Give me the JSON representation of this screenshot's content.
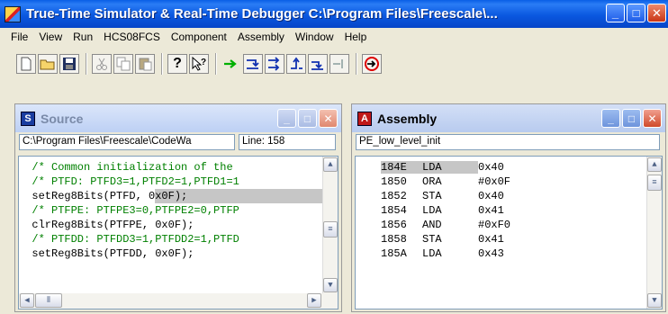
{
  "app": {
    "title": "True-Time Simulator & Real-Time Debugger   C:\\Program Files\\Freescale\\...",
    "min_label": "_",
    "max_label": "□",
    "close_label": "✕"
  },
  "menu": [
    "File",
    "View",
    "Run",
    "HCS08FCS",
    "Component",
    "Assembly",
    "Window",
    "Help"
  ],
  "toolbar": {
    "icons": [
      "new-file-icon",
      "open-folder-icon",
      "save-icon",
      "cut-icon",
      "copy-icon",
      "paste-icon",
      "help-icon",
      "context-help-icon",
      "start-continue-icon",
      "single-step-icon",
      "step-over-icon",
      "step-out-icon",
      "assembly-step-icon",
      "halt-icon",
      "reset-icon"
    ],
    "glyphs": {
      "new": "🗋",
      "open": "📂",
      "save": "💾",
      "cut": "✂",
      "copy": "⎘",
      "paste": "📋",
      "help": "?",
      "context_help": "?",
      "go": "→",
      "step": "⇥",
      "step_over": "⇉",
      "step_out": "↰",
      "asm_step": "⇣",
      "halt": "⏸",
      "reset": "⟲"
    }
  },
  "source_window": {
    "title": "Source",
    "icon_letter": "S",
    "path": "C:\\Program Files\\Freescale\\CodeWa",
    "line_info": "Line: 158",
    "lines": [
      {
        "text": "  /* Common initialization of the",
        "type": "comment"
      },
      {
        "text": "  /* PTFD: PTFD3=1,PTFD2=1,PTFD1=1",
        "type": "comment"
      },
      {
        "text": "  setReg8Bits(PTFD, 0x0F);",
        "type": "code",
        "highlight_from": 21
      },
      {
        "text": "  /* PTFPE: PTFPE3=0,PTFPE2=0,PTFP",
        "type": "comment"
      },
      {
        "text": "  clrReg8Bits(PTFPE, 0x0F);",
        "type": "code"
      },
      {
        "text": "  /* PTFDD: PTFDD3=1,PTFDD2=1,PTFD",
        "type": "comment"
      },
      {
        "text": "  setReg8Bits(PTFDD, 0x0F);",
        "type": "code"
      }
    ]
  },
  "assembly_window": {
    "title": "Assembly",
    "icon_letter": "A",
    "function": "PE_low_level_init",
    "lines": [
      {
        "addr": "184E",
        "op": "LDA",
        "arg": "0x40",
        "highlight": true
      },
      {
        "addr": "1850",
        "op": "ORA",
        "arg": "#0x0F"
      },
      {
        "addr": "1852",
        "op": "STA",
        "arg": "0x40"
      },
      {
        "addr": "1854",
        "op": "LDA",
        "arg": "0x41"
      },
      {
        "addr": "1856",
        "op": "AND",
        "arg": "#0xF0"
      },
      {
        "addr": "1858",
        "op": "STA",
        "arg": "0x41"
      },
      {
        "addr": "185A",
        "op": "LDA",
        "arg": "0x43"
      }
    ]
  },
  "colors": {
    "comment": "#008000",
    "highlight": "#c6c6c6",
    "titlebar": "#0a58e0"
  }
}
